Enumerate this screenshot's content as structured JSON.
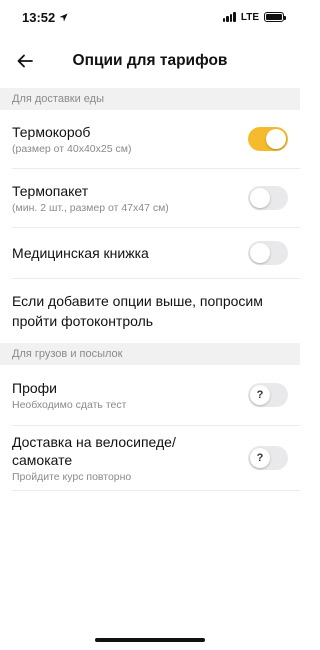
{
  "status_bar": {
    "time": "13:52",
    "network": "LTE",
    "icons": [
      "location-arrow-icon",
      "signal-bars-icon",
      "battery-icon"
    ]
  },
  "header": {
    "title": "Опции для тарифов",
    "back_icon": "arrow-left-icon"
  },
  "sections": [
    {
      "header": "Для доставки еды",
      "items": [
        {
          "title": "Термокороб",
          "subtitle": "(размер от 40x40x25 см)",
          "toggle": "on"
        },
        {
          "title": "Термопакет",
          "subtitle": "(мин. 2 шт., размер от 47x47 см)",
          "toggle": "off"
        },
        {
          "title": "Медицинская книжка",
          "subtitle": "",
          "toggle": "off"
        }
      ],
      "note": "Если добавите опции выше, попросим пройти фотоконтроль"
    },
    {
      "header": "Для грузов и посылок",
      "items": [
        {
          "title": "Профи",
          "subtitle": "Необходимо сдать тест",
          "toggle": "locked",
          "knob_label": "?"
        },
        {
          "title": "Доставка на велосипеде/ самокате",
          "subtitle": "Пройдите курс повторно",
          "toggle": "locked",
          "knob_label": "?"
        }
      ]
    }
  ],
  "colors": {
    "toggle_on": "#f5bb2c",
    "toggle_off": "#e9e9eb",
    "section_bg": "#f1f1f1",
    "secondary_text": "#8a8a8a"
  }
}
